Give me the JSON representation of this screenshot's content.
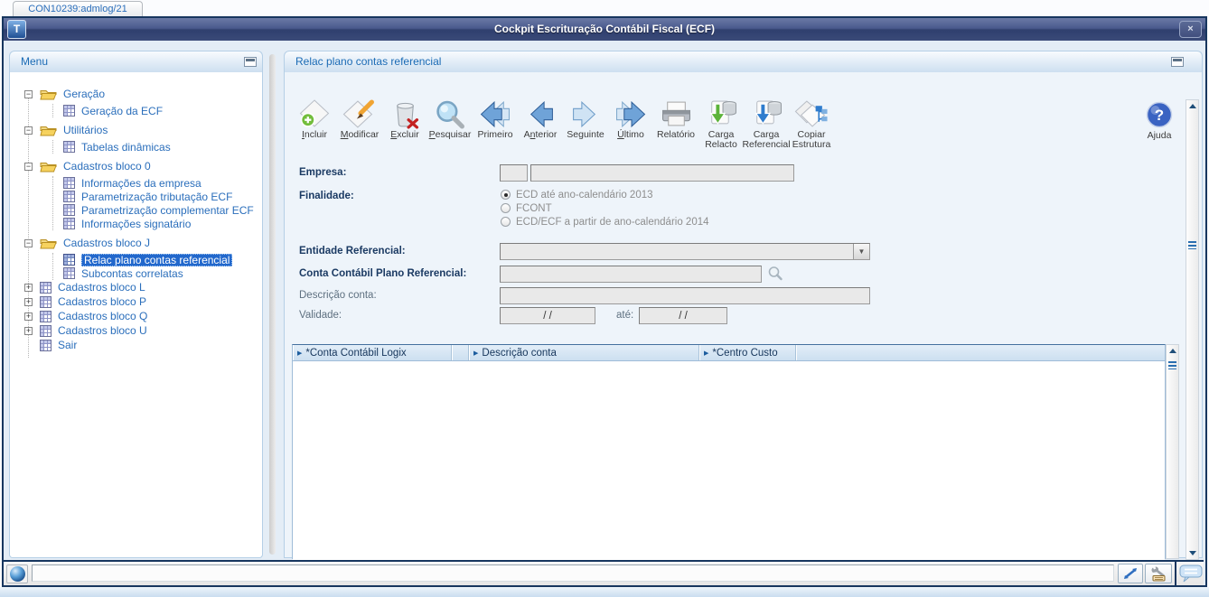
{
  "colors": {
    "selection_blue": "#2268cc",
    "titlebar_blue": "#3a4a78",
    "navy": "#17365f",
    "link_blue": "#2a6ebb",
    "header_text_blue": "#1b6bb5"
  },
  "icons": {
    "close": "×",
    "combo_arrow": "▼",
    "column_arrow": "▶",
    "help_glyph": "?"
  },
  "tab_bar": {
    "session_tab": "CON10239:admlog/21"
  },
  "window": {
    "title": "Cockpit Escrituração Contábil Fiscal (ECF)",
    "logo_letter": "T"
  },
  "menu": {
    "title": "Menu",
    "items": [
      {
        "label": "Geração",
        "icon": "folder",
        "expander": "minus"
      },
      {
        "label": "Geração da ECF",
        "icon": "grid"
      },
      {
        "label": "Utilitários",
        "icon": "folder",
        "expander": "minus"
      },
      {
        "label": "Tabelas dinâmicas",
        "icon": "grid"
      },
      {
        "label": "Cadastros bloco 0",
        "icon": "folder",
        "expander": "minus"
      },
      {
        "label": "Informações da empresa",
        "icon": "grid"
      },
      {
        "label": "Parametrização tributação ECF",
        "icon": "grid"
      },
      {
        "label": "Parametrização complementar ECF",
        "icon": "grid"
      },
      {
        "label": "Informações signatário",
        "icon": "grid"
      },
      {
        "label": "Cadastros bloco J",
        "icon": "folder",
        "expander": "minus"
      },
      {
        "label": "Relac plano contas referencial",
        "icon": "grid",
        "selected": true
      },
      {
        "label": "Subcontas correlatas",
        "icon": "grid"
      },
      {
        "label": "Cadastros bloco L",
        "icon": "grid",
        "expander": "plus"
      },
      {
        "label": "Cadastros bloco P",
        "icon": "grid",
        "expander": "plus"
      },
      {
        "label": "Cadastros bloco Q",
        "icon": "grid",
        "expander": "plus"
      },
      {
        "label": "Cadastros bloco U",
        "icon": "grid",
        "expander": "plus"
      },
      {
        "label": "Sair",
        "icon": "grid"
      }
    ]
  },
  "panel": {
    "title": "Relac plano contas referencial",
    "toolbar": [
      {
        "name": "incluir",
        "pre": "",
        "accel": "I",
        "post": "ncluir"
      },
      {
        "name": "modificar",
        "pre": "",
        "accel": "M",
        "post": "odificar"
      },
      {
        "name": "excluir",
        "pre": "",
        "accel": "E",
        "post": "xcluir"
      },
      {
        "name": "pesquisar",
        "pre": "",
        "accel": "P",
        "post": "esquisar"
      },
      {
        "name": "primeiro",
        "pre": "Primeiro",
        "accel": "",
        "post": ""
      },
      {
        "name": "anterior",
        "pre": "A",
        "accel": "n",
        "post": "terior"
      },
      {
        "name": "seguinte",
        "pre": "Se",
        "accel": "g",
        "post": "uinte"
      },
      {
        "name": "ultimo",
        "pre": "",
        "accel": "Ú",
        "post": "ltimo"
      },
      {
        "name": "relatorio",
        "pre": "Relatório",
        "accel": "",
        "post": ""
      },
      {
        "name": "carga-relacto",
        "pre": "Carga",
        "accel": "",
        "post": "",
        "line2": "Relacto"
      },
      {
        "name": "carga-referencial",
        "pre": "Carga",
        "accel": "",
        "post": "",
        "line2": "Referencial"
      },
      {
        "name": "copiar-estrutura",
        "pre": "Copiar",
        "accel": "",
        "post": "",
        "line2": "Estrutura"
      }
    ],
    "help": {
      "label": "Ajuda"
    },
    "form": {
      "empresa": {
        "label": "Empresa:",
        "code_value": "",
        "name_value": ""
      },
      "finalidade": {
        "label": "Finalidade:",
        "options": [
          {
            "label": "ECD até ano-calendário 2013",
            "checked": true
          },
          {
            "label": "FCONT",
            "checked": false
          },
          {
            "label": "ECD/ECF a partir de ano-calendário 2014",
            "checked": false
          }
        ]
      },
      "entidade": {
        "label": "Entidade Referencial:",
        "value": ""
      },
      "conta": {
        "label": "Conta Contábil Plano Referencial:",
        "value": ""
      },
      "descricao": {
        "label": "Descrição conta:",
        "value": ""
      },
      "validade": {
        "label": "Validade:",
        "from_value": "/ /",
        "ate_label": "até:",
        "to_value": "/ /"
      }
    },
    "grid": {
      "columns": [
        {
          "label": "*Conta Contábil Logix"
        },
        {
          "label": "Descrição conta"
        },
        {
          "label": "*Centro Custo"
        }
      ],
      "rows": []
    }
  },
  "status_bar": {
    "message": ""
  }
}
